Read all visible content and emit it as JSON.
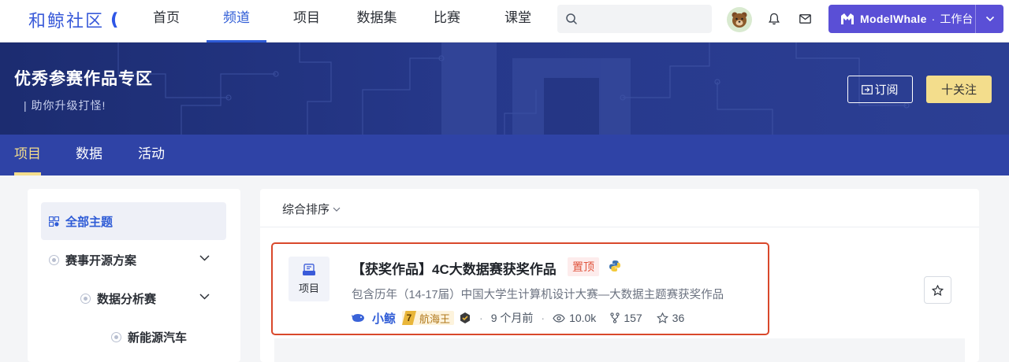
{
  "topnav": {
    "logo_text": "和鲸社区",
    "items": [
      {
        "label": "首页"
      },
      {
        "label": "频道"
      },
      {
        "label": "项目"
      },
      {
        "label": "数据集"
      },
      {
        "label": "比赛"
      },
      {
        "label": "课堂"
      }
    ],
    "active_index": 1,
    "search_placeholder": "",
    "workbench": {
      "brand": "ModelWhale",
      "sep": "·",
      "label": "工作台"
    }
  },
  "banner": {
    "title": "优秀参赛作品专区",
    "subtitle": "|  助你升级打怪!",
    "subscribe_label": "订阅",
    "follow_label": "十关注"
  },
  "subtabs": [
    {
      "label": "项目"
    },
    {
      "label": "数据"
    },
    {
      "label": "活动"
    }
  ],
  "sidebar": {
    "all_label": "全部主题",
    "items": [
      {
        "label": "赛事开源方案"
      },
      {
        "label": "数据分析赛"
      },
      {
        "label": "新能源汽车"
      }
    ]
  },
  "main": {
    "sort_label": "综合排序",
    "card": {
      "type_label": "项目",
      "title": "【获奖作品】4C大数据赛获奖作品",
      "pin_label": "置顶",
      "description": "包含历年（14-17届）中国大学生计算机设计大赛—大数据主题赛获奖作品",
      "author": "小鲸",
      "level_num": "7",
      "level_name": "航海王",
      "time": "9 个月前",
      "views": "10.0k",
      "forks": "157",
      "stars": "36"
    }
  },
  "colors": {
    "accent": "#2e5bd6",
    "workbench_bg": "#5a4fd6",
    "banner_bg": "#26388a",
    "subtabs_bg": "#2f43a6",
    "follow_bg": "#f3dd8c",
    "highlight_border": "#d9482b"
  }
}
